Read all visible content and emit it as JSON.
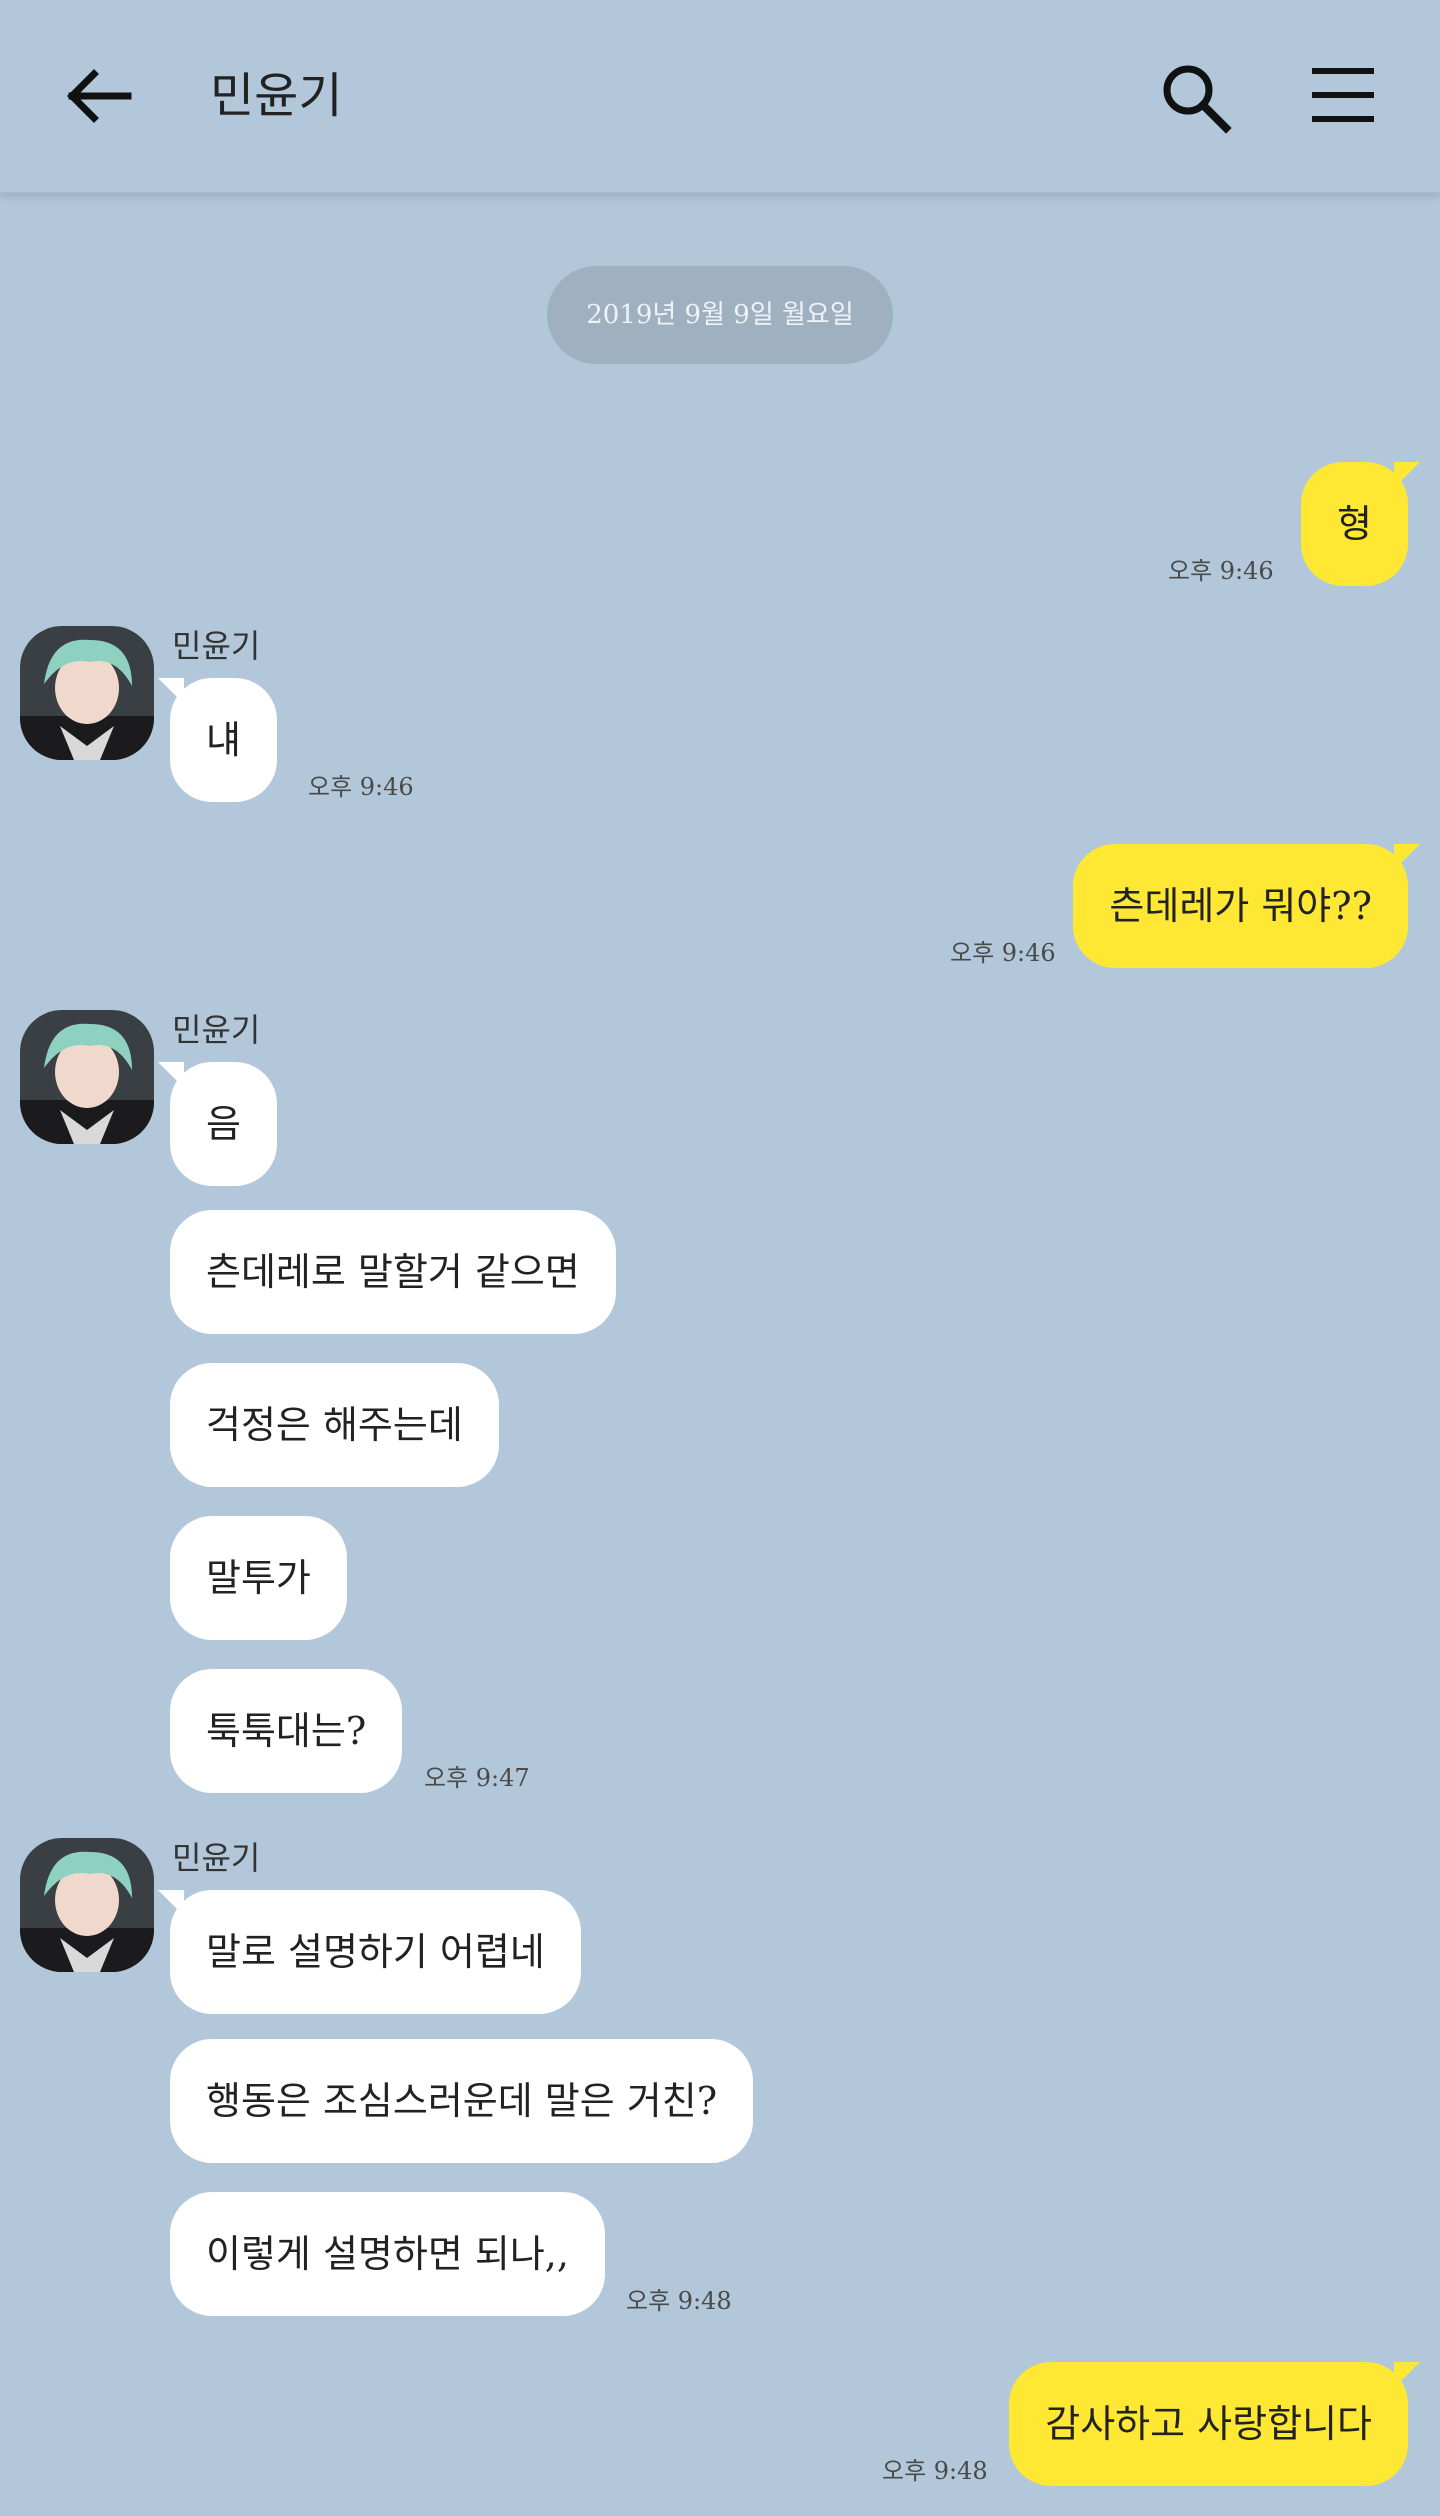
{
  "header": {
    "title": "민윤기",
    "back_icon": "arrow-left-icon",
    "search_icon": "search-icon",
    "menu_icon": "hamburger-menu-icon"
  },
  "colors": {
    "background": "#b2c7da",
    "incoming_bubble": "#ffffff",
    "outgoing_bubble": "#fee833",
    "date_pill": "#9fb1c1"
  },
  "date_divider": "2019년 9월 9일 월요일",
  "contact": {
    "name": "민윤기"
  },
  "messages": [
    {
      "dir": "out",
      "text": "형",
      "time": "오후 9:46"
    },
    {
      "dir": "in",
      "text": "냬",
      "time": "오후 9:46"
    },
    {
      "dir": "out",
      "text": "츤데레가 뭐야??",
      "time": "오후 9:46"
    },
    {
      "dir": "in",
      "text": "음"
    },
    {
      "dir": "in",
      "text": "츤데레로 말할거 같으면"
    },
    {
      "dir": "in",
      "text": "걱정은 해주는데"
    },
    {
      "dir": "in",
      "text": "말투가"
    },
    {
      "dir": "in",
      "text": "툭툭대는?",
      "time": "오후 9:47"
    },
    {
      "dir": "in",
      "text": "말로 설명하기 어렵네"
    },
    {
      "dir": "in",
      "text": "행동은 조심스러운데 말은 거친?"
    },
    {
      "dir": "in",
      "text": "이렇게 설명하면 되나,,",
      "time": "오후 9:48"
    },
    {
      "dir": "out",
      "text": "감사하고 사랑합니다",
      "time": "오후 9:48"
    }
  ]
}
